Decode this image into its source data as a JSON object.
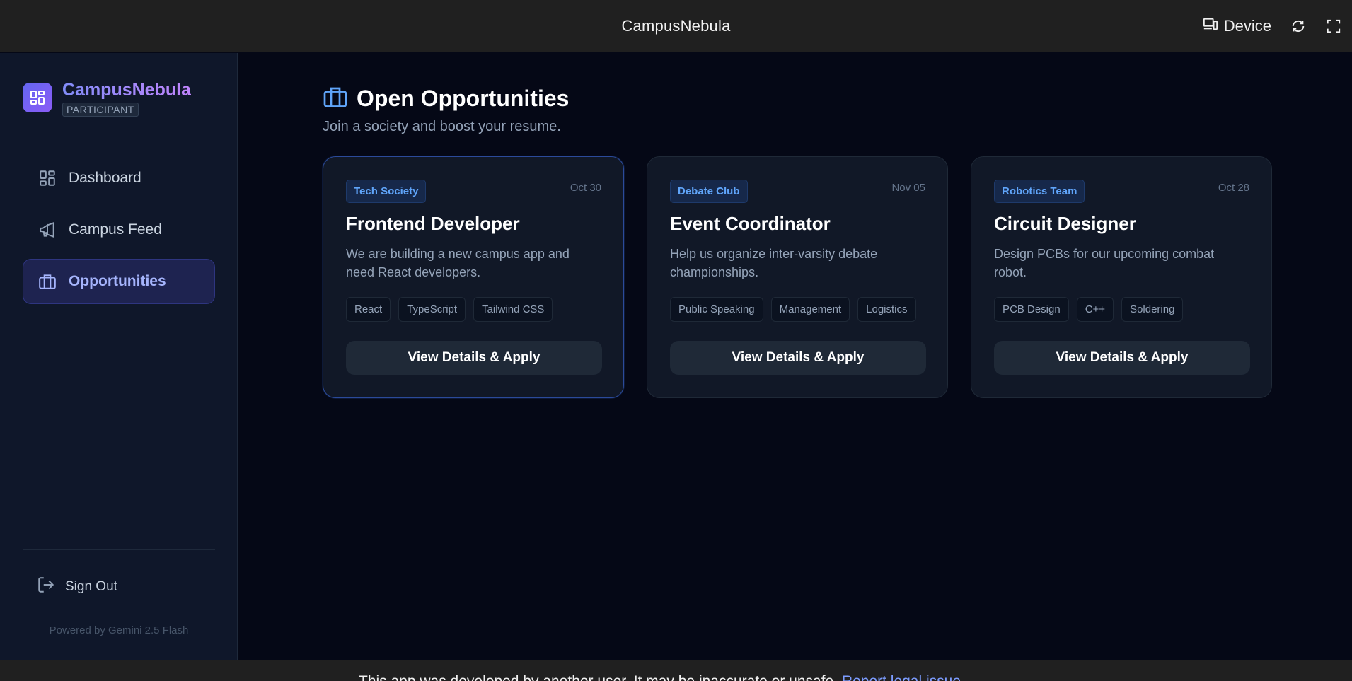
{
  "topbar": {
    "title": "CampusNebula",
    "device_label": "Device"
  },
  "sidebar": {
    "brand_name": "CampusNebula",
    "brand_role": "PARTICIPANT",
    "items": [
      {
        "label": "Dashboard",
        "icon": "grid-icon",
        "active": false
      },
      {
        "label": "Campus Feed",
        "icon": "megaphone-icon",
        "active": false
      },
      {
        "label": "Opportunities",
        "icon": "briefcase-icon",
        "active": true
      }
    ],
    "sign_out_label": "Sign Out",
    "powered_by": "Powered by Gemini 2.5 Flash"
  },
  "main": {
    "title": "Open Opportunities",
    "subtitle": "Join a society and boost your resume.",
    "cards": [
      {
        "tag": "Tech Society",
        "date": "Oct 30",
        "title": "Frontend Developer",
        "description": "We are building a new campus app and need React developers.",
        "skills": [
          "React",
          "TypeScript",
          "Tailwind CSS"
        ],
        "button": "View Details & Apply"
      },
      {
        "tag": "Debate Club",
        "date": "Nov 05",
        "title": "Event Coordinator",
        "description": "Help us organize inter-varsity debate championships.",
        "skills": [
          "Public Speaking",
          "Management",
          "Logistics"
        ],
        "button": "View Details & Apply"
      },
      {
        "tag": "Robotics Team",
        "date": "Oct 28",
        "title": "Circuit Designer",
        "description": "Design PCBs for our upcoming combat robot.",
        "skills": [
          "PCB Design",
          "C++",
          "Soldering"
        ],
        "button": "View Details & Apply"
      }
    ]
  },
  "disclaimer": {
    "text": "This app was developed by another user. It may be inaccurate or unsafe.",
    "link": "Report legal issue"
  },
  "colors": {
    "background": "#050816",
    "sidebar": "#0f172a",
    "accent": "#818cf8",
    "tag": "#60a5fa"
  }
}
